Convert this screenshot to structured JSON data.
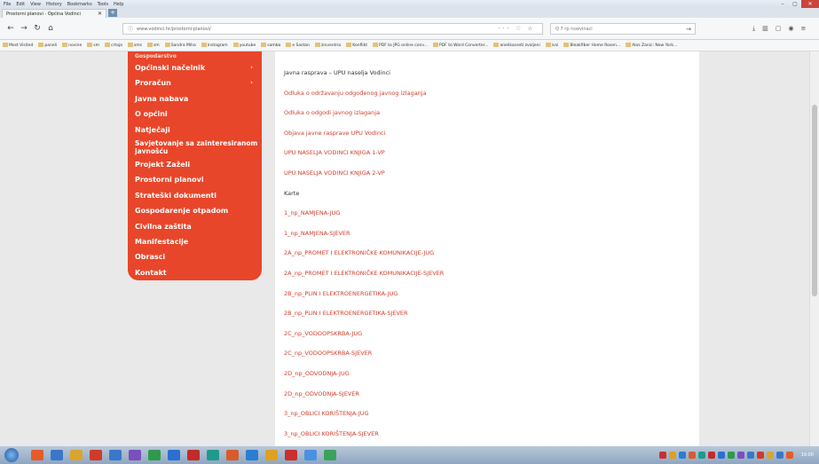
{
  "window": {
    "menu": [
      "File",
      "Edit",
      "View",
      "History",
      "Bookmarks",
      "Tools",
      "Help"
    ],
    "tab_title": "Prostorni planovi - Općina Vodinci",
    "tab_close": "✕",
    "new_tab": "+"
  },
  "nav": {
    "url": "www.vodinci.hr/prostorni-planovi/",
    "url_actions": "··· ♡ ☆",
    "search": "Q  7 rp nswvinaci",
    "search_go": "→"
  },
  "bookmarks": [
    "Most Visited",
    "paneli",
    "novine",
    "sm",
    "crtaja",
    "sms",
    "sm",
    "Sandra Miha",
    "Instagram",
    "youtube",
    "samba",
    "e Sastan",
    "zinventrio",
    "Konflikt",
    "PDF to JPG online conv...",
    "PDF to Word Converter...",
    "anelikacesti zvoljeni",
    "ivsi",
    "Bleakfiber Home Rosen...",
    "Alos Zanic: New York..."
  ],
  "sidebar": {
    "cut_item": "Gospodarstvo",
    "items": [
      {
        "label": "Općinski načelnik",
        "chevron": true
      },
      {
        "label": "Proračun",
        "chevron": true
      },
      {
        "label": "Javna nabava",
        "chevron": false
      },
      {
        "label": "O općini",
        "chevron": false
      },
      {
        "label": "Natječaji",
        "chevron": false
      },
      {
        "label": "Savjetovanje sa zainteresiranom javnošću",
        "chevron": false,
        "two_line": true
      },
      {
        "label": "Projekt Zaželi",
        "chevron": false
      },
      {
        "label": "Prostorni planovi",
        "chevron": false
      },
      {
        "label": "Strateški dokumenti",
        "chevron": false
      },
      {
        "label": "Gospodarenje otpadom",
        "chevron": false
      },
      {
        "label": "Civilna zaštita",
        "chevron": false
      },
      {
        "label": "Manifestacije",
        "chevron": false
      },
      {
        "label": "Obrasci",
        "chevron": false
      },
      {
        "label": "Kontakt",
        "chevron": false
      }
    ],
    "chevron_glyph": "›"
  },
  "content": {
    "links": [
      {
        "text": "Javna rasprava – UPU naselja Vodinci",
        "dark": true
      },
      {
        "text": "Odluka o održavanju odgođenog javnog izlaganja",
        "dark": false
      },
      {
        "text": "Odluka o odgodi javnog izlaganja",
        "dark": false
      },
      {
        "text": "Objava javne rasprave UPU Vodinci",
        "dark": false
      },
      {
        "text": "UPU NASELJA VODINCI KNJIGA 1-VP",
        "dark": false
      },
      {
        "text": "UPU NASELJA VODINCI KNJIGA 2-VP",
        "dark": false
      },
      {
        "text": "Karte",
        "dark": true
      },
      {
        "text": "1_np_NAMJENA-JUG",
        "dark": false
      },
      {
        "text": "1_np_NAMJENA-SJEVER",
        "dark": false
      },
      {
        "text": "2A_np_PROMET I ELEKTRONIČKE KOMUNIKACIJE-JUG",
        "dark": false
      },
      {
        "text": "2A_np_PROMET I ELEKTRONIČKE KOMUNIKACIJE-SJEVER",
        "dark": false
      },
      {
        "text": "2B_np_PLIN I ELEKTROENERGETIKA-JUG",
        "dark": false
      },
      {
        "text": "2B_np_PLIN I ELEKTROENERGETIKA-SJEVER",
        "dark": false
      },
      {
        "text": "2C_np_VODOOPSKRBA-JUG",
        "dark": false
      },
      {
        "text": "2C_np_VODOOPSKRBA-SJEVER",
        "dark": false
      },
      {
        "text": "2D_np_ODVODNJA-JUG",
        "dark": false
      },
      {
        "text": "2D_np_ODVODNJA-SJEVER",
        "dark": false
      },
      {
        "text": "3_np_OBLICI KORIŠTENJA-JUG",
        "dark": false
      },
      {
        "text": "3_np_OBLICI KORIŠTENJA-SJEVER",
        "dark": false
      }
    ]
  },
  "taskbar": {
    "clock": "19:00",
    "icon_colors": [
      "#e55b2a",
      "#3a77c9",
      "#d9a530",
      "#cf3a2b",
      "#3a77c9",
      "#7a4fbf",
      "#2f9a4b",
      "#2a6fd1",
      "#c42a2a",
      "#1f9a8a",
      "#d85b2a",
      "#2b7cd3",
      "#e0a020",
      "#c92f2f",
      "#4a90e2",
      "#3aa35a"
    ]
  }
}
